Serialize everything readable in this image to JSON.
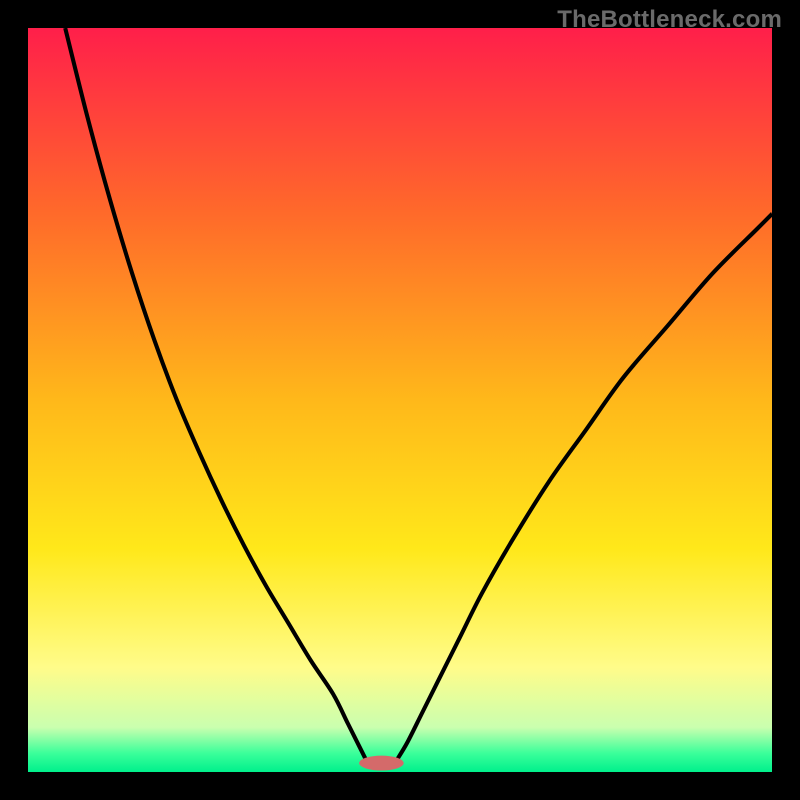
{
  "watermark": "TheBottleneck.com",
  "chart_data": {
    "type": "line",
    "title": "",
    "xlabel": "",
    "ylabel": "",
    "xlim": [
      0,
      100
    ],
    "ylim": [
      0,
      100
    ],
    "background_gradient_stops": [
      {
        "offset": 0.0,
        "color": "#ff1f4a"
      },
      {
        "offset": 0.25,
        "color": "#ff6a2a"
      },
      {
        "offset": 0.5,
        "color": "#ffb81a"
      },
      {
        "offset": 0.7,
        "color": "#ffe81a"
      },
      {
        "offset": 0.86,
        "color": "#fffc8a"
      },
      {
        "offset": 0.94,
        "color": "#caffaf"
      },
      {
        "offset": 0.975,
        "color": "#3aff9a"
      },
      {
        "offset": 1.0,
        "color": "#00f08c"
      }
    ],
    "curve_left": {
      "x": [
        5,
        8,
        11,
        14,
        17,
        20,
        23,
        26,
        29,
        32,
        35,
        38,
        41,
        43,
        44.5,
        45.5
      ],
      "y": [
        100,
        88,
        77,
        67,
        58,
        50,
        43,
        36.5,
        30.5,
        25,
        20,
        15,
        10.5,
        6.5,
        3.5,
        1.5
      ]
    },
    "curve_right": {
      "x": [
        49.5,
        51,
        53,
        55,
        58,
        61,
        65,
        70,
        75,
        80,
        86,
        92,
        98,
        100
      ],
      "y": [
        1.5,
        4,
        8,
        12,
        18,
        24,
        31,
        39,
        46,
        53,
        60,
        67,
        73,
        75
      ]
    },
    "marker": {
      "x": 47.5,
      "y": 1.2,
      "rx": 3.0,
      "ry": 1.0,
      "color": "#d46a6a"
    }
  }
}
